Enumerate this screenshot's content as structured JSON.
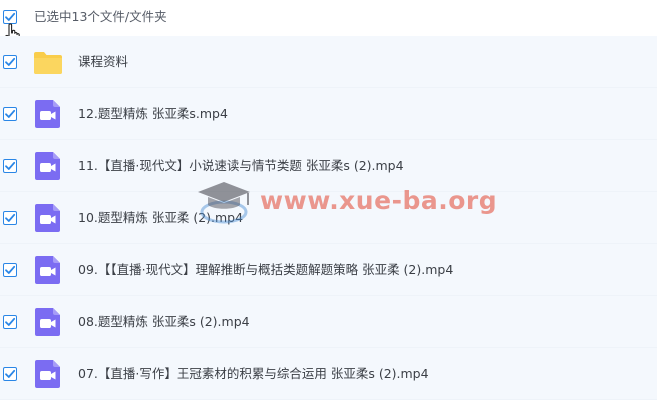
{
  "header": {
    "selection_text": "已选中13个文件/文件夹",
    "select_all_checked": true
  },
  "rows": [
    {
      "type": "folder",
      "name": "课程资料",
      "checked": true,
      "icon": "folder-icon"
    },
    {
      "type": "video",
      "name": "12.题型精炼 张亚柔s.mp4",
      "checked": true,
      "icon": "video-file-icon"
    },
    {
      "type": "video",
      "name": "11.【直播·现代文】小说速读与情节类题 张亚柔s (2).mp4",
      "checked": true,
      "icon": "video-file-icon"
    },
    {
      "type": "video",
      "name": "10.题型精炼 张亚柔 (2).mp4",
      "checked": true,
      "icon": "video-file-icon"
    },
    {
      "type": "video",
      "name": "09.【【直播·现代文】理解推断与概括类题解题策略 张亚柔 (2).mp4",
      "checked": true,
      "icon": "video-file-icon"
    },
    {
      "type": "video",
      "name": "08.题型精炼 张亚柔s (2).mp4",
      "checked": true,
      "icon": "video-file-icon"
    },
    {
      "type": "video",
      "name": "07.【直播·写作】王冠素材的积累与综合运用 张亚柔s (2).mp4",
      "checked": true,
      "icon": "video-file-icon"
    }
  ],
  "watermark": {
    "text": "www.xue-ba.org"
  },
  "colors": {
    "checkbox": "#2a86e6",
    "folder": "#f9cd4b",
    "video_icon": "#7b6cf2",
    "row_background": "#f4f8fd",
    "watermark": "#e24632"
  }
}
